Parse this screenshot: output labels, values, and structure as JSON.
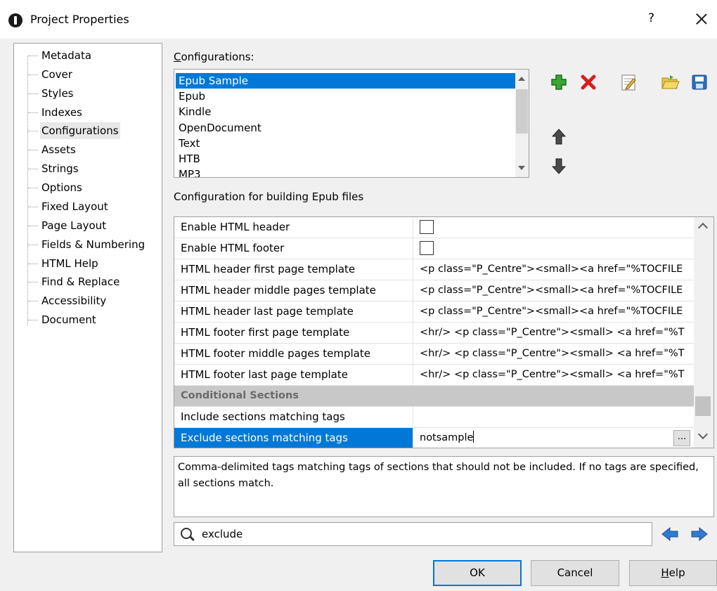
{
  "window": {
    "title": "Project Properties",
    "help_glyph": "?"
  },
  "nav": {
    "items": [
      "Metadata",
      "Cover",
      "Styles",
      "Indexes",
      "Configurations",
      "Assets",
      "Strings",
      "Options",
      "Fixed Layout",
      "Page Layout",
      "Fields & Numbering",
      "HTML Help",
      "Find & Replace",
      "Accessibility",
      "Document"
    ],
    "selected": "Configurations"
  },
  "configurations": {
    "label_prefix": "C",
    "label_rest": "onfigurations:",
    "items": [
      "Epub Sample",
      "Epub",
      "Kindle",
      "OpenDocument",
      "Text",
      "HTB",
      "MP3"
    ],
    "selected": "Epub Sample"
  },
  "toolbar_icons": [
    "add-icon",
    "delete-icon",
    "edit-icon",
    "open-folder-icon",
    "save-icon",
    "move-up-icon",
    "move-down-icon"
  ],
  "settings_heading": "Configuration for building Epub files",
  "grid": {
    "rows": {
      "r0": {
        "key": "Enable HTML header"
      },
      "r1": {
        "key": "Enable HTML footer"
      },
      "r2": {
        "key": "HTML header first page template",
        "value": "<p class=\"P_Centre\"><small><a href=\"%TOCFILE"
      },
      "r3": {
        "key": "HTML header middle pages template",
        "value": "<p class=\"P_Centre\"><small><a href=\"%TOCFILE"
      },
      "r4": {
        "key": "HTML header last page template",
        "value": "<p class=\"P_Centre\"><small><a href=\"%TOCFILE"
      },
      "r5": {
        "key": "HTML footer first page template",
        "value": "<hr/> <p class=\"P_Centre\"><small> <a href=\"%T"
      },
      "r6": {
        "key": "HTML footer middle pages template",
        "value": "<hr/> <p class=\"P_Centre\"><small> <a href=\"%T"
      },
      "r7": {
        "key": "HTML footer last page template",
        "value": "<hr/> <p class=\"P_Centre\"><small> <a href=\"%T"
      },
      "r8": {
        "key": "Conditional Sections"
      },
      "r9": {
        "key": "Include sections matching tags",
        "value": ""
      },
      "r10": {
        "key": "Exclude sections matching tags",
        "value": "notsample"
      }
    },
    "ellipsis": "..."
  },
  "description": "Comma-delimited tags matching tags of sections that should not be included. If no tags are specified, all sections match.",
  "search": {
    "value": "exclude"
  },
  "buttons": {
    "ok": "OK",
    "cancel": "Cancel",
    "help_prefix": "H",
    "help_rest": "elp"
  },
  "colors": {
    "selection": "#0078d7",
    "category": "#c8c8c8"
  }
}
